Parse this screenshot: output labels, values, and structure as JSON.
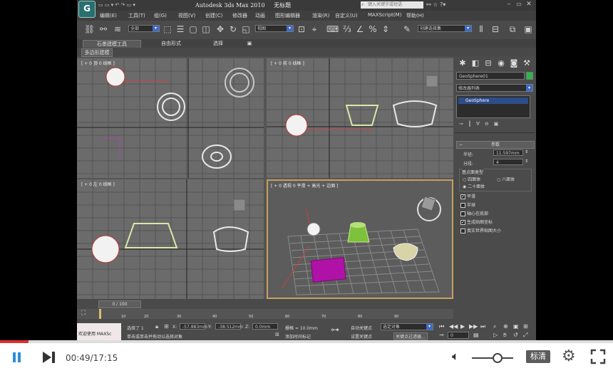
{
  "window": {
    "title": "Autodesk 3ds Max  2010",
    "subtitle": "无标题",
    "search_placeholder": "键入关键字或短语"
  },
  "menubar": {
    "items": [
      "编辑(E)",
      "工具(T)",
      "组(G)",
      "视图(V)",
      "创建(C)",
      "修改器",
      "动画",
      "图形编辑器",
      "渲染(R)",
      "自定义(U)",
      "MAXScript(M)",
      "帮助(H)"
    ]
  },
  "toolbar": {
    "selection_filter": "全部",
    "ref_coord": "视图",
    "named_selection": "创建选择集"
  },
  "ribbon": {
    "tabs": [
      "石墨建模工具",
      "自由形式",
      "选择",
      "▣"
    ],
    "subtab": "多边形建模"
  },
  "viewports": {
    "top_left_label": "[ + 0 顶 0 线框 ]",
    "top_right_label": "[ + 0 前 0 线框 ]",
    "bottom_left_label": "[ + 0 左 0 线框 ]",
    "bottom_right_label": "[ + 0 透视 0 平滑 + 高光 + 边面 ]"
  },
  "command_panel": {
    "object_name": "GeoSphere01",
    "object_color": "#2db84a",
    "modifier_list": "修改器列表",
    "stack_item": "GeoSphere",
    "rollout_title": "参数",
    "radius_label": "半径:",
    "radius_value": "11.597mm",
    "segments_label": "分段:",
    "segments_value": "4",
    "base_type_label": "基点面类型",
    "base_types": [
      "四面体",
      "八面体",
      "二十面体"
    ],
    "base_type_selected": "二十面体",
    "checks": [
      {
        "label": "平滑",
        "checked": true
      },
      {
        "label": "半球",
        "checked": false
      },
      {
        "label": "轴心在底部",
        "checked": false
      },
      {
        "label": "生成贴图坐标",
        "checked": true
      },
      {
        "label": "真实世界贴图大小",
        "checked": false
      }
    ]
  },
  "timeline": {
    "frame_display": "0 / 100",
    "ticks": [
      "10",
      "20",
      "30",
      "40",
      "50",
      "60",
      "70",
      "80",
      "90"
    ]
  },
  "status": {
    "welcome": "欢迎使用 MAXSc",
    "selected": "选择了 1",
    "x_label": "X:",
    "x_value": "-57.883mm",
    "y_label": "Y:",
    "y_value": "-38.512mm",
    "z_label": "Z:",
    "z_value": "0.0mm",
    "grid": "栅格 = 10.0mm",
    "prompt": "单击或单击并拖动以选择对象",
    "add_time_tag": "添加时间标记",
    "auto_key": "自动关键点",
    "selected_object": "选定对象",
    "set_key": "设置关键点",
    "key_filters": "关键点过滤器...",
    "frame": "0"
  },
  "player": {
    "time": "00:49/17:15",
    "quality": "标清",
    "progress": 0.047,
    "volume": 0.6,
    "progress_color": "#e03030"
  }
}
